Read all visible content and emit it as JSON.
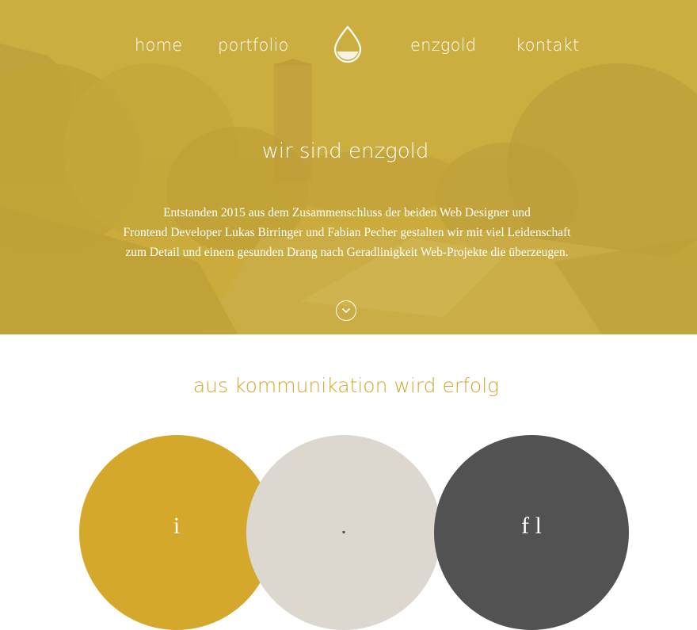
{
  "nav": {
    "items": [
      {
        "label": "home"
      },
      {
        "label": "portfolio"
      },
      {
        "label": "enzgold"
      },
      {
        "label": "kontakt"
      }
    ]
  },
  "hero": {
    "title": "wir sind enzgold",
    "paragraph_lines": [
      "Entstanden 2015 aus dem Zusammenschluss der beiden Web Designer und",
      "Frontend Developer Lukas Birringer und Fabian Pecher gestalten wir mit viel Leidenschaft",
      "zum Detail und einem gesunden Drang nach Geradlinigkeit Web-Projekte die überzeugen."
    ],
    "overlay_color": "#c4a63a"
  },
  "section": {
    "title": "aus kommunikation wird erfolg",
    "title_color": "#d4a82a",
    "circles": [
      {
        "color": "#d4a82a",
        "label": "i"
      },
      {
        "color": "#dcd7cf",
        "label": "."
      },
      {
        "color": "#525252",
        "label": "f l"
      }
    ]
  }
}
